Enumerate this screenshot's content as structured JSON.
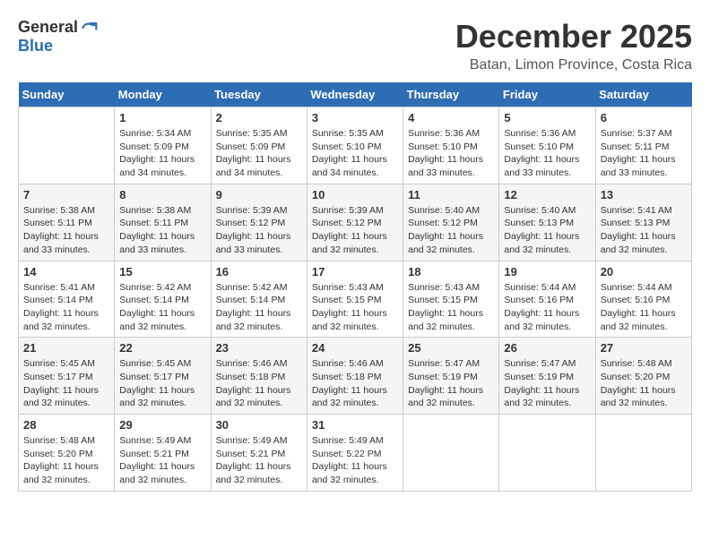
{
  "header": {
    "logo_general": "General",
    "logo_blue": "Blue",
    "month_title": "December 2025",
    "subtitle": "Batan, Limon Province, Costa Rica"
  },
  "days_of_week": [
    "Sunday",
    "Monday",
    "Tuesday",
    "Wednesday",
    "Thursday",
    "Friday",
    "Saturday"
  ],
  "weeks": [
    {
      "days": [
        {
          "num": "",
          "content": ""
        },
        {
          "num": "1",
          "content": "Sunrise: 5:34 AM\nSunset: 5:09 PM\nDaylight: 11 hours\nand 34 minutes."
        },
        {
          "num": "2",
          "content": "Sunrise: 5:35 AM\nSunset: 5:09 PM\nDaylight: 11 hours\nand 34 minutes."
        },
        {
          "num": "3",
          "content": "Sunrise: 5:35 AM\nSunset: 5:10 PM\nDaylight: 11 hours\nand 34 minutes."
        },
        {
          "num": "4",
          "content": "Sunrise: 5:36 AM\nSunset: 5:10 PM\nDaylight: 11 hours\nand 33 minutes."
        },
        {
          "num": "5",
          "content": "Sunrise: 5:36 AM\nSunset: 5:10 PM\nDaylight: 11 hours\nand 33 minutes."
        },
        {
          "num": "6",
          "content": "Sunrise: 5:37 AM\nSunset: 5:11 PM\nDaylight: 11 hours\nand 33 minutes."
        }
      ]
    },
    {
      "days": [
        {
          "num": "7",
          "content": "Sunrise: 5:38 AM\nSunset: 5:11 PM\nDaylight: 11 hours\nand 33 minutes."
        },
        {
          "num": "8",
          "content": "Sunrise: 5:38 AM\nSunset: 5:11 PM\nDaylight: 11 hours\nand 33 minutes."
        },
        {
          "num": "9",
          "content": "Sunrise: 5:39 AM\nSunset: 5:12 PM\nDaylight: 11 hours\nand 33 minutes."
        },
        {
          "num": "10",
          "content": "Sunrise: 5:39 AM\nSunset: 5:12 PM\nDaylight: 11 hours\nand 32 minutes."
        },
        {
          "num": "11",
          "content": "Sunrise: 5:40 AM\nSunset: 5:12 PM\nDaylight: 11 hours\nand 32 minutes."
        },
        {
          "num": "12",
          "content": "Sunrise: 5:40 AM\nSunset: 5:13 PM\nDaylight: 11 hours\nand 32 minutes."
        },
        {
          "num": "13",
          "content": "Sunrise: 5:41 AM\nSunset: 5:13 PM\nDaylight: 11 hours\nand 32 minutes."
        }
      ]
    },
    {
      "days": [
        {
          "num": "14",
          "content": "Sunrise: 5:41 AM\nSunset: 5:14 PM\nDaylight: 11 hours\nand 32 minutes."
        },
        {
          "num": "15",
          "content": "Sunrise: 5:42 AM\nSunset: 5:14 PM\nDaylight: 11 hours\nand 32 minutes."
        },
        {
          "num": "16",
          "content": "Sunrise: 5:42 AM\nSunset: 5:14 PM\nDaylight: 11 hours\nand 32 minutes."
        },
        {
          "num": "17",
          "content": "Sunrise: 5:43 AM\nSunset: 5:15 PM\nDaylight: 11 hours\nand 32 minutes."
        },
        {
          "num": "18",
          "content": "Sunrise: 5:43 AM\nSunset: 5:15 PM\nDaylight: 11 hours\nand 32 minutes."
        },
        {
          "num": "19",
          "content": "Sunrise: 5:44 AM\nSunset: 5:16 PM\nDaylight: 11 hours\nand 32 minutes."
        },
        {
          "num": "20",
          "content": "Sunrise: 5:44 AM\nSunset: 5:16 PM\nDaylight: 11 hours\nand 32 minutes."
        }
      ]
    },
    {
      "days": [
        {
          "num": "21",
          "content": "Sunrise: 5:45 AM\nSunset: 5:17 PM\nDaylight: 11 hours\nand 32 minutes."
        },
        {
          "num": "22",
          "content": "Sunrise: 5:45 AM\nSunset: 5:17 PM\nDaylight: 11 hours\nand 32 minutes."
        },
        {
          "num": "23",
          "content": "Sunrise: 5:46 AM\nSunset: 5:18 PM\nDaylight: 11 hours\nand 32 minutes."
        },
        {
          "num": "24",
          "content": "Sunrise: 5:46 AM\nSunset: 5:18 PM\nDaylight: 11 hours\nand 32 minutes."
        },
        {
          "num": "25",
          "content": "Sunrise: 5:47 AM\nSunset: 5:19 PM\nDaylight: 11 hours\nand 32 minutes."
        },
        {
          "num": "26",
          "content": "Sunrise: 5:47 AM\nSunset: 5:19 PM\nDaylight: 11 hours\nand 32 minutes."
        },
        {
          "num": "27",
          "content": "Sunrise: 5:48 AM\nSunset: 5:20 PM\nDaylight: 11 hours\nand 32 minutes."
        }
      ]
    },
    {
      "days": [
        {
          "num": "28",
          "content": "Sunrise: 5:48 AM\nSunset: 5:20 PM\nDaylight: 11 hours\nand 32 minutes."
        },
        {
          "num": "29",
          "content": "Sunrise: 5:49 AM\nSunset: 5:21 PM\nDaylight: 11 hours\nand 32 minutes."
        },
        {
          "num": "30",
          "content": "Sunrise: 5:49 AM\nSunset: 5:21 PM\nDaylight: 11 hours\nand 32 minutes."
        },
        {
          "num": "31",
          "content": "Sunrise: 5:49 AM\nSunset: 5:22 PM\nDaylight: 11 hours\nand 32 minutes."
        },
        {
          "num": "",
          "content": ""
        },
        {
          "num": "",
          "content": ""
        },
        {
          "num": "",
          "content": ""
        }
      ]
    }
  ]
}
